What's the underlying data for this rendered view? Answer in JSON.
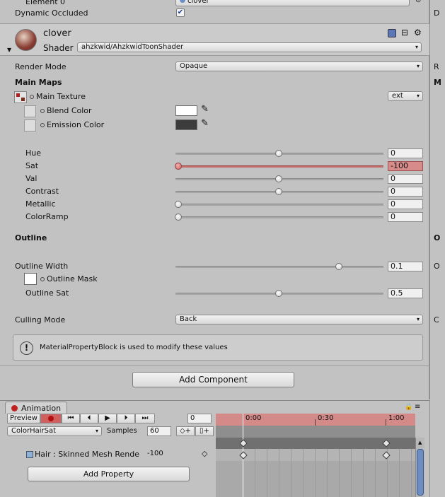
{
  "top": {
    "element0_label": "Element 0",
    "element0_value": "clover",
    "dynamic_occluded_label": "Dynamic Occluded",
    "dynamic_occluded_checked": "✔"
  },
  "material": {
    "name": "clover",
    "shader_label": "Shader",
    "shader_value": "ahzkwid/AhzkwidToonShader",
    "render_mode_label": "Render Mode",
    "render_mode_value": "Opaque",
    "main_maps_label": "Main Maps",
    "main_texture_label": "Main Texture",
    "main_texture_dropdown": "ext",
    "blend_color_label": "Blend Color",
    "emission_color_label": "Emission Color",
    "colors": {
      "blend": "#ffffff",
      "emission": "#3c3c3c",
      "accent_red": "#d58a8a"
    }
  },
  "sliders": [
    {
      "label": "Hue",
      "value": "0",
      "fraction": 0.5,
      "highlight": false
    },
    {
      "label": "Sat",
      "value": "-100",
      "fraction": 0.0,
      "highlight": true
    },
    {
      "label": "Val",
      "value": "0",
      "fraction": 0.5,
      "highlight": false
    },
    {
      "label": "Contrast",
      "value": "0",
      "fraction": 0.5,
      "highlight": false
    },
    {
      "label": "Metallic",
      "value": "0",
      "fraction": 0.0,
      "highlight": false
    },
    {
      "label": "ColorRamp",
      "value": "0",
      "fraction": 0.0,
      "highlight": false
    }
  ],
  "outline": {
    "section_label": "Outline",
    "width_label": "Outline Width",
    "width_value": "0.1",
    "width_fraction": 0.8,
    "mask_label": "Outline Mask",
    "sat_label": "Outline Sat",
    "sat_value": "0.5",
    "sat_fraction": 0.5
  },
  "culling": {
    "label": "Culling Mode",
    "value": "Back"
  },
  "info_box": {
    "text": "MaterialPropertyBlock is used to modify these values"
  },
  "add_component_label": "Add Component",
  "right_strip": {
    "d1": "D",
    "r": "R",
    "m": "M",
    "o": "O",
    "c": "C"
  },
  "animation": {
    "tab_label": "Animation",
    "preview_label": "Preview",
    "frame_value": "0",
    "clip_name": "ColorHairSat",
    "samples_label": "Samples",
    "samples_value": "60",
    "time_labels": [
      "0:00",
      "0:30",
      "1:00"
    ],
    "property_label": "Hair : Skinned Mesh Rende",
    "property_value": "-100",
    "add_property_label": "Add Property"
  }
}
